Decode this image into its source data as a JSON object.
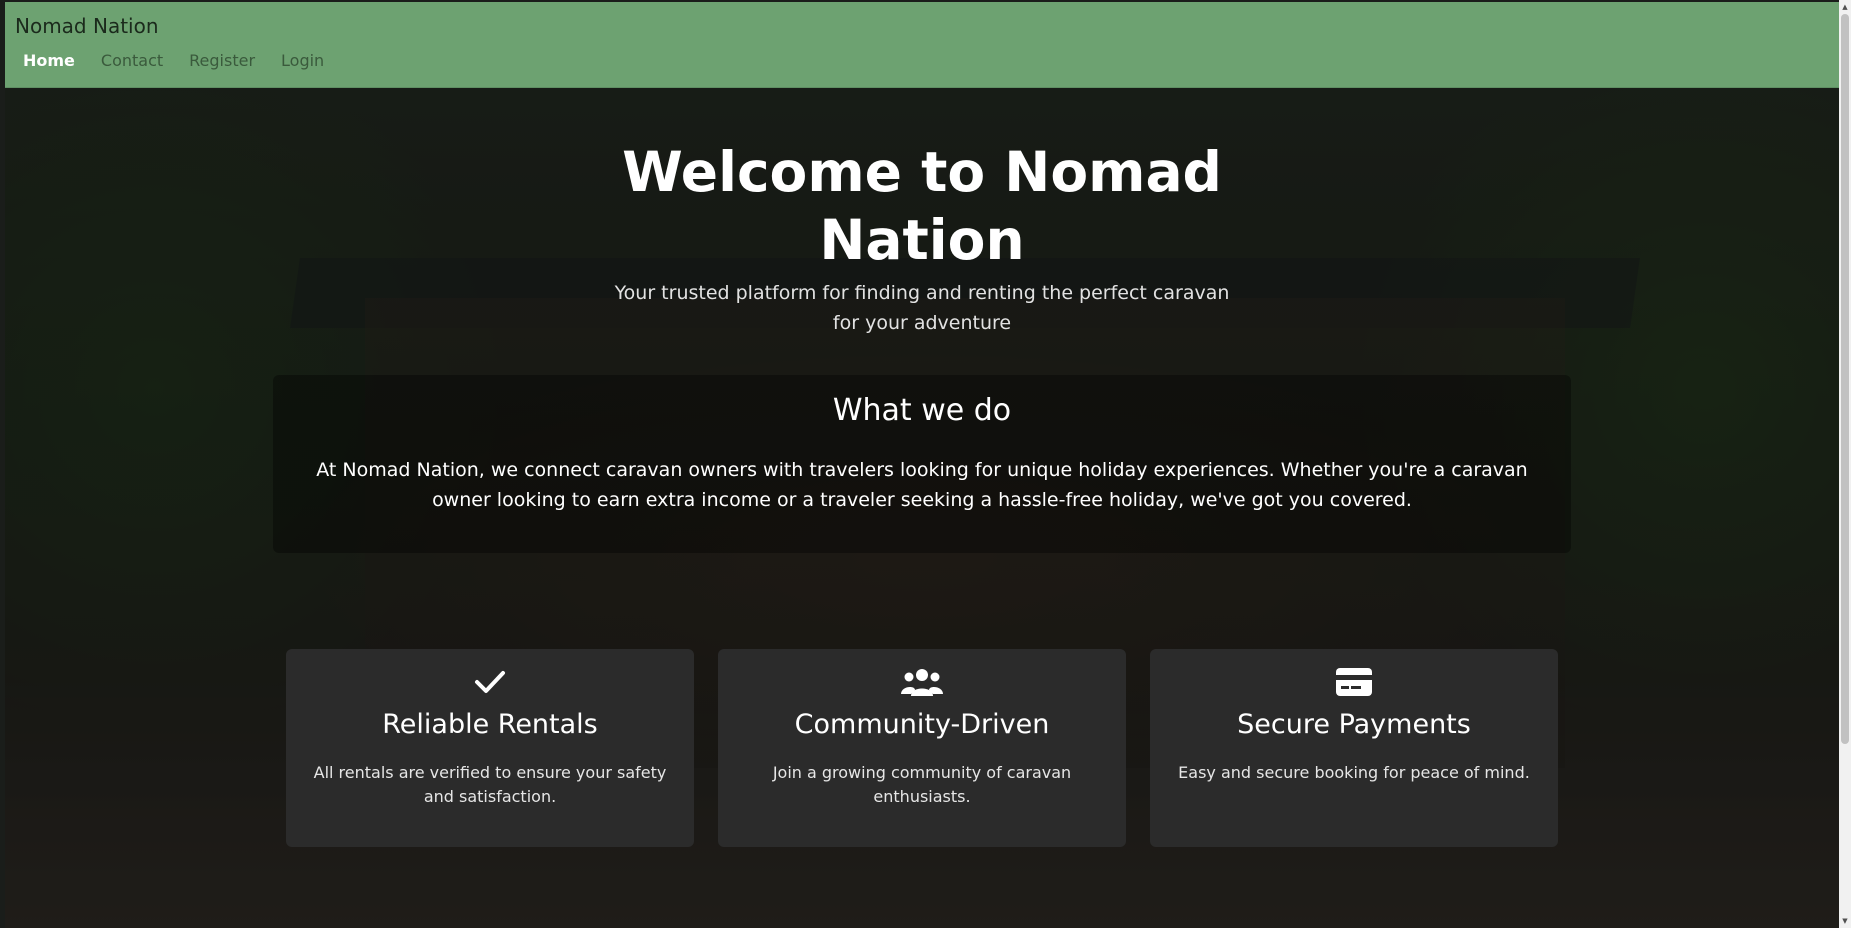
{
  "navbar": {
    "brand": "Nomad Nation",
    "links": [
      {
        "label": "Home",
        "active": true
      },
      {
        "label": "Contact",
        "active": false
      },
      {
        "label": "Register",
        "active": false
      },
      {
        "label": "Login",
        "active": false
      }
    ],
    "bg_color": "#6da271"
  },
  "hero": {
    "title_line1": "Welcome to Nomad",
    "title_line2": "Nation",
    "subtitle_line1": "Your trusted platform for finding and renting the perfect caravan",
    "subtitle_line2": "for your adventure"
  },
  "what_we_do": {
    "title": "What we do",
    "text": "At Nomad Nation, we connect caravan owners with travelers looking for unique holiday experiences. Whether you're a caravan owner looking to earn extra income or a traveler seeking a hassle-free holiday, we've got you covered."
  },
  "features": [
    {
      "icon": "check-icon",
      "title": "Reliable Rentals",
      "text": "All rentals are verified to ensure your safety and satisfaction."
    },
    {
      "icon": "users-icon",
      "title": "Community-Driven",
      "text": "Join a growing community of caravan enthusiasts."
    },
    {
      "icon": "credit-card-icon",
      "title": "Secure Payments",
      "text": "Easy and secure booking for peace of mind."
    }
  ],
  "colors": {
    "card_bg": "#2b2b2b",
    "text": "#ffffff"
  }
}
